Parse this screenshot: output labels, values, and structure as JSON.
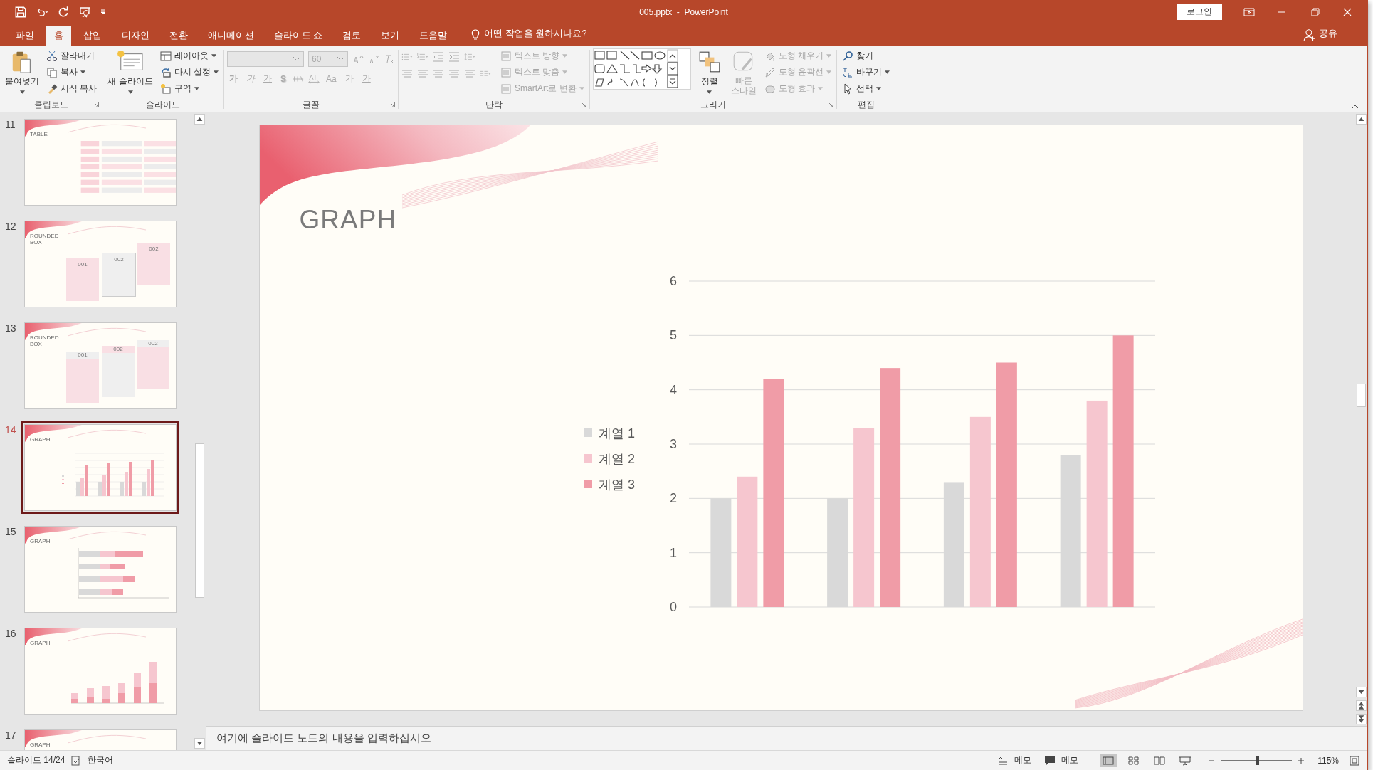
{
  "title_bar": {
    "title": "005.pptx  -  PowerPoint",
    "login": "로그인"
  },
  "menu": {
    "tabs": [
      {
        "label": "파일",
        "selected": false
      },
      {
        "label": "홈",
        "selected": true
      },
      {
        "label": "삽입",
        "selected": false
      },
      {
        "label": "디자인",
        "selected": false
      },
      {
        "label": "전환",
        "selected": false
      },
      {
        "label": "애니메이션",
        "selected": false
      },
      {
        "label": "슬라이드 쇼",
        "selected": false
      },
      {
        "label": "검토",
        "selected": false
      },
      {
        "label": "보기",
        "selected": false
      },
      {
        "label": "도움말",
        "selected": false
      }
    ],
    "tell_me": "어떤 작업을 원하시나요?",
    "share": "공유"
  },
  "ribbon": {
    "groups": [
      {
        "kind": "clipboard",
        "label": "클립보드",
        "big": {
          "label": "붙여넣기",
          "disabled": false
        },
        "items": [
          {
            "label": "잘라내기",
            "disabled": false
          },
          {
            "label": "복사",
            "disabled": false
          },
          {
            "label": "서식 복사",
            "disabled": false
          }
        ]
      },
      {
        "kind": "slides",
        "label": "슬라이드",
        "big": {
          "label": "새 슬라이드",
          "disabled": false
        },
        "items": [
          {
            "label": "레이아웃",
            "disabled": false
          },
          {
            "label": "다시 설정",
            "disabled": false
          },
          {
            "label": "구역",
            "disabled": false
          }
        ]
      },
      {
        "kind": "font",
        "label": "글꼴",
        "disabled": true,
        "font_size": "60",
        "tools": [
          "가",
          "가",
          "가",
          "S",
          "Aa",
          "가",
          "가"
        ]
      },
      {
        "kind": "paragraph",
        "label": "단락",
        "disabled": true,
        "items": [
          {
            "label": "텍스트 방향",
            "disabled": true
          },
          {
            "label": "텍스트 맞춤",
            "disabled": true
          },
          {
            "label": "SmartArt로 변환",
            "disabled": true
          }
        ]
      },
      {
        "kind": "drawing",
        "label": "그리기",
        "big": {
          "label": "정렬",
          "disabled": false
        },
        "style": {
          "label": "빠른 스타일",
          "disabled": true
        },
        "items": [
          {
            "label": "도형 채우기",
            "disabled": true
          },
          {
            "label": "도형 윤곽선",
            "disabled": true
          },
          {
            "label": "도형 효과",
            "disabled": true
          }
        ]
      },
      {
        "kind": "editing",
        "label": "편집",
        "items": [
          {
            "label": "찾기",
            "disabled": false
          },
          {
            "label": "바꾸기",
            "disabled": false
          },
          {
            "label": "선택",
            "disabled": false
          }
        ]
      }
    ]
  },
  "thumbnails": [
    {
      "number": "11",
      "kind": "table",
      "title": "TABLE",
      "selected": false
    },
    {
      "number": "12",
      "kind": "boxes",
      "title": "ROUNDED BOX",
      "boxes": [
        "001",
        "002",
        "002"
      ],
      "selected": false
    },
    {
      "number": "13",
      "kind": "header_boxes",
      "title": "ROUNDED BOX",
      "boxes": [
        "001",
        "002",
        "002"
      ],
      "selected": false
    },
    {
      "number": "14",
      "kind": "chart",
      "title": "GRAPH",
      "selected": true
    },
    {
      "number": "15",
      "kind": "hbar",
      "title": "GRAPH",
      "selected": false
    },
    {
      "number": "16",
      "kind": "column",
      "title": "GRAPH",
      "selected": false
    },
    {
      "number": "17",
      "kind": "partial",
      "title": "GRAPH",
      "selected": false
    }
  ],
  "slide": {
    "title": "GRAPH",
    "chart_data": {
      "type": "bar",
      "grid": true,
      "legend": true,
      "ylim": [
        0,
        6
      ],
      "yticks": [
        0,
        1,
        2,
        3,
        4,
        5,
        6
      ],
      "series": [
        {
          "name": "계열 1",
          "color": "#d9d9d9",
          "values": [
            2,
            2,
            2.3,
            2.8
          ]
        },
        {
          "name": "계열 2",
          "color": "#f6c6cf",
          "values": [
            2.4,
            3.3,
            3.5,
            3.8
          ]
        },
        {
          "name": "계열 3",
          "color": "#f09ca7",
          "values": [
            4.2,
            4.4,
            4.5,
            5
          ]
        }
      ]
    }
  },
  "notes": {
    "placeholder": "여기에 슬라이드 노트의 내용을 입력하십시오"
  },
  "status_bar": {
    "slide": "슬라이드 14/24",
    "language": "한국어",
    "notes": "메모",
    "comments": "메모",
    "views": [
      {
        "selected": true
      },
      {
        "selected": false
      },
      {
        "selected": false
      },
      {
        "selected": false
      }
    ],
    "zoom_slider": {
      "level": 0.52
    },
    "zoom": "115%"
  }
}
